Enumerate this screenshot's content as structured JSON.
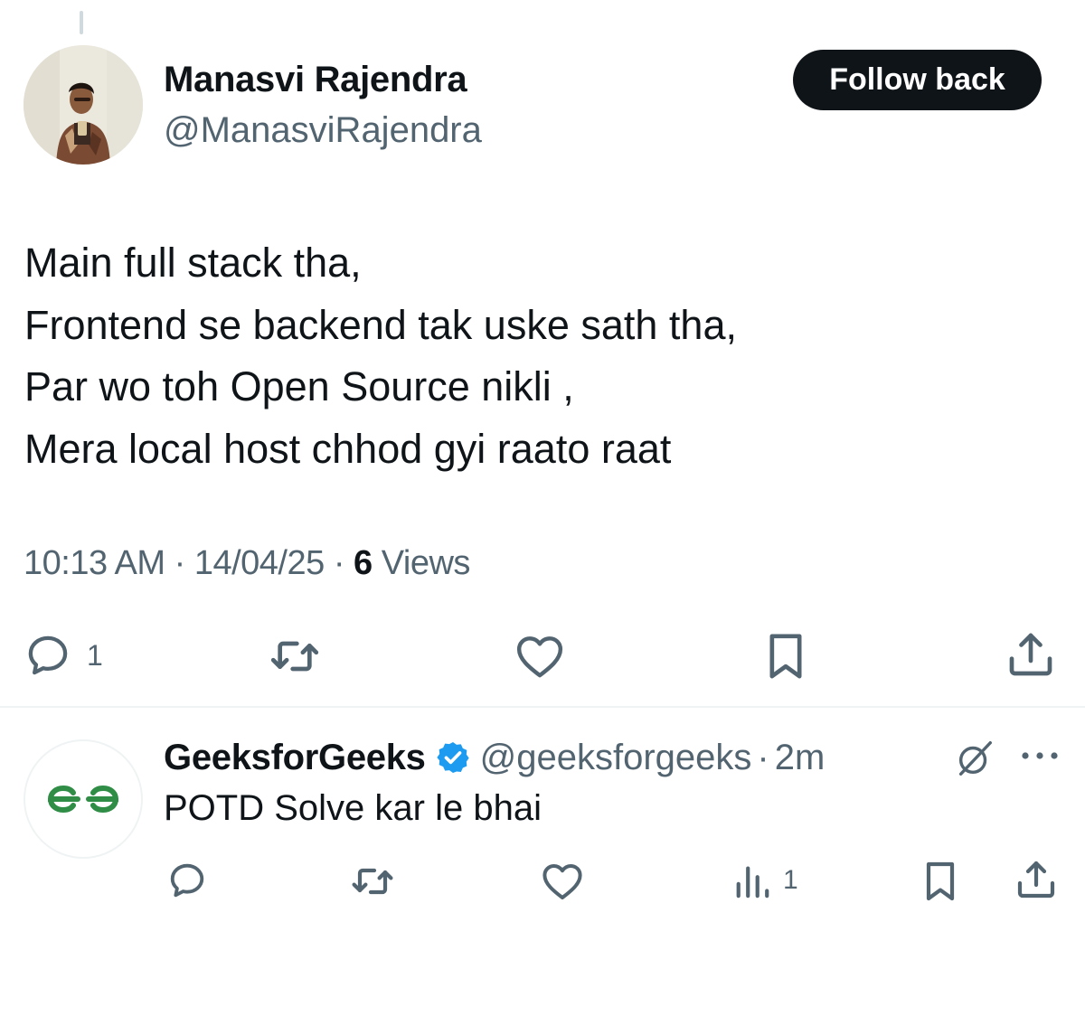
{
  "author": {
    "name": "Manasvi Rajendra",
    "handle": "@ManasviRajendra",
    "follow_label": "Follow back"
  },
  "tweet": {
    "lines": [
      "Main full stack tha,",
      "Frontend se backend tak uske sath tha,",
      "Par wo toh Open Source nikli ,",
      "Mera local host chhod gyi raato raat"
    ],
    "time": "10:13 AM",
    "separator": "·",
    "date": "14/04/25",
    "views_count": "6",
    "views_label": "Views",
    "actions": {
      "reply_count": "1"
    }
  },
  "reply": {
    "name": "GeeksforGeeks",
    "handle": "@geeksforgeeks",
    "separator": "·",
    "time": "2m",
    "text": "POTD Solve kar le bhai",
    "views_count": "1"
  },
  "icons": {
    "reply": "reply-icon",
    "retweet": "retweet-icon",
    "like": "heart-icon",
    "bookmark": "bookmark-icon",
    "share": "share-icon",
    "views": "views-chart-icon",
    "verified": "verified-badge-icon",
    "grok": "grok-icon",
    "more": "more-dots-icon"
  },
  "colors": {
    "text": "#0f1419",
    "secondary": "#536471",
    "verified": "#1d9bf0",
    "gfg_green": "#2f8d46",
    "follow_bg": "#0f1419"
  }
}
